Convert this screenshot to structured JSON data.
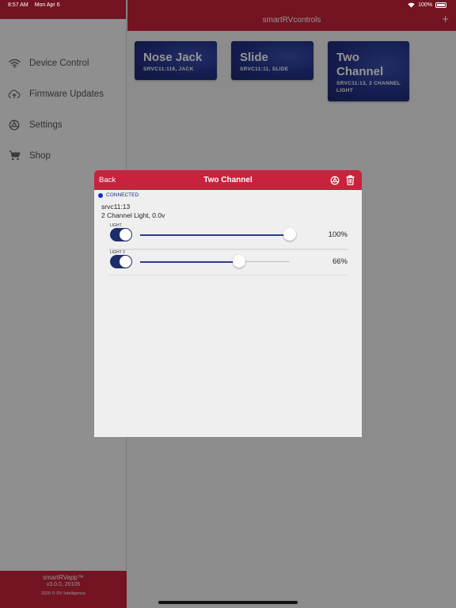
{
  "status": {
    "time": "8:57 AM",
    "date": "Mon Apr 6",
    "battery": "100%"
  },
  "header": {
    "title": "smartRVcontrols",
    "add_label": "+"
  },
  "sidebar": {
    "items": [
      {
        "label": "Device Control",
        "icon": "wifi-icon"
      },
      {
        "label": "Firmware Updates",
        "icon": "cloud-upload-icon"
      },
      {
        "label": "Settings",
        "icon": "gear-icon"
      },
      {
        "label": "Shop",
        "icon": "cart-icon"
      }
    ],
    "footer": {
      "app_name": "smartRVapp™",
      "version": "v3.0.0, 20105",
      "copyright": "2020 © RV Intelligence"
    }
  },
  "devices": [
    {
      "name": "Nose Jack",
      "subtitle": "SRVC11:116, JACK"
    },
    {
      "name": "Slide",
      "subtitle": "SRVC11:11, SLIDE"
    },
    {
      "name": "Two Channel",
      "subtitle": "SRVC11:13, 2 CHANNEL LIGHT"
    }
  ],
  "modal": {
    "back_label": "Back",
    "title": "Two Channel",
    "connection": "CONNECTED",
    "device_id": "srvc11:13",
    "device_desc": "2 Channel Light, 0.0v",
    "channels": [
      {
        "label": "LIGHT",
        "on": true,
        "level": 1.0,
        "value_text": "100%"
      },
      {
        "label": "LIGHT 2",
        "on": true,
        "level": 0.66,
        "value_text": "66%"
      }
    ]
  },
  "colors": {
    "brand_red": "#c8223c",
    "card_blue": "#24338a",
    "toggle_on": "#1c2d6a",
    "connected_dot": "#1a2acc"
  }
}
